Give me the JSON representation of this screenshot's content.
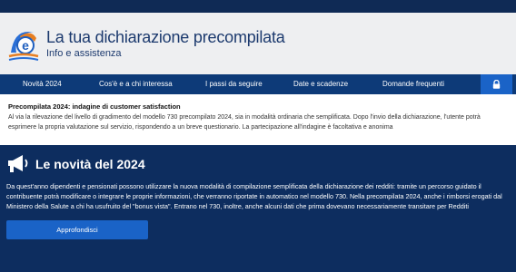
{
  "header": {
    "title": "La tua dichiarazione precompilata",
    "subtitle": "Info e assistenza"
  },
  "nav": {
    "items": [
      {
        "label": "Novità 2024"
      },
      {
        "label": "Cos'è e a chi interessa"
      },
      {
        "label": "I passi da seguire"
      },
      {
        "label": "Date e scadenze"
      },
      {
        "label": "Domande frequenti"
      }
    ],
    "lock_icon": "lock-icon"
  },
  "notice": {
    "title": "Precompilata 2024: indagine di customer satisfaction",
    "text": "Al via la rilevazione del livello di gradimento del modello 730 precompilato 2024, sia in modalità ordinaria che semplificata. Dopo l'invio della dichiarazione, l'utente potrà esprimere la propria valutazione sul servizio, rispondendo a un breve questionario. La partecipazione all'indagine è facoltativa e anonima"
  },
  "news": {
    "icon": "megaphone-icon",
    "title": "Le novità del 2024",
    "text": "Da quest'anno dipendenti e pensionati possono utilizzare la nuova modalità di compilazione semplificata della dichiarazione dei redditi: tramite un percorso guidato il contribuente potrà modificare o integrare le proprie informazioni, che verranno riportate in automatico nel modello 730. Nella precompilata 2024, anche i rimborsi erogati dal Ministero della Salute a chi ha usufruito del \"bonus vista\". Entrano nel 730, inoltre, anche alcuni dati che prima dovevano necessariamente transitare per Redditi",
    "button_label": "Approfondisci"
  },
  "colors": {
    "top_strip": "#0f2a55",
    "nav_bg": "#0d3a78",
    "accent": "#1a63c7",
    "news_bg": "#0d2d5f",
    "title_text": "#1c3a6e"
  }
}
